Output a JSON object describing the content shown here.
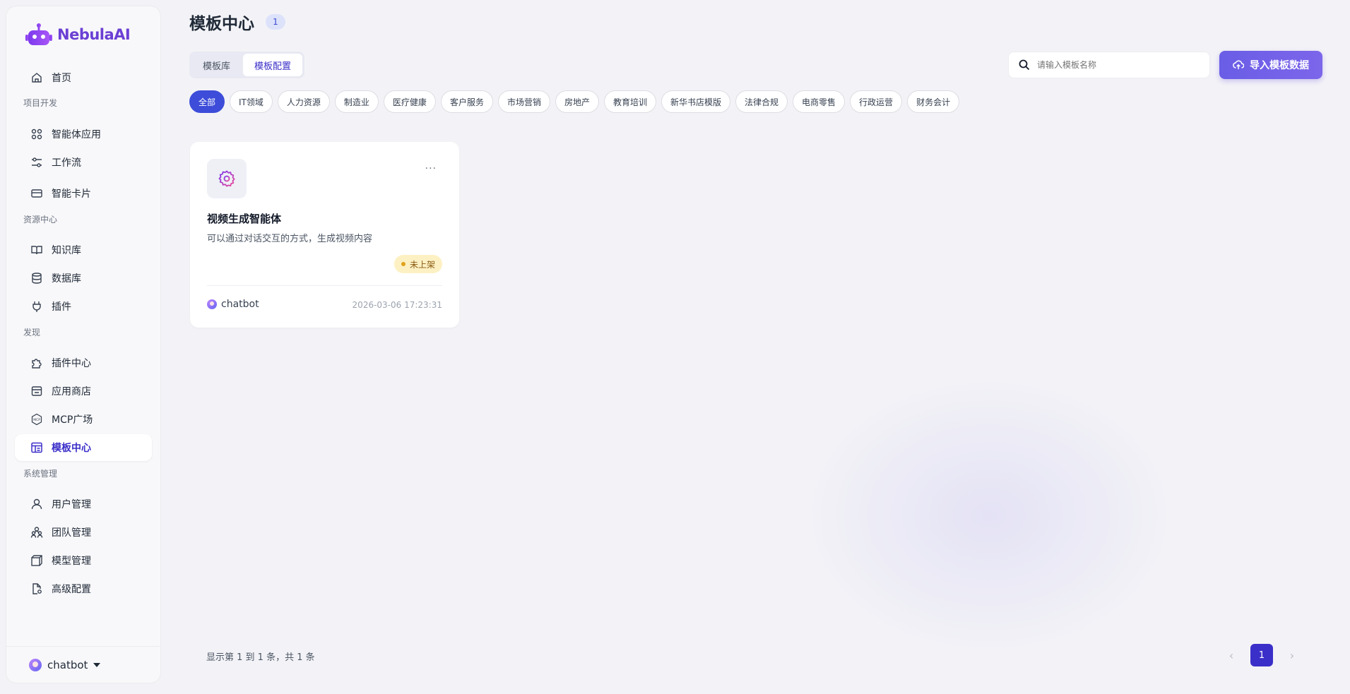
{
  "app": {
    "brand": "NebulaAI",
    "accent": "#3b2fc9"
  },
  "sidebar": {
    "home": "首页",
    "sections": {
      "dev": "项目开发",
      "resources": "资源中心",
      "discover": "发现",
      "system": "系统管理"
    },
    "items": {
      "agent_apps": "智能体应用",
      "workflow": "工作流",
      "smart_cards": "智能卡片",
      "knowledge": "知识库",
      "database": "数据库",
      "plugins": "插件",
      "plugin_center": "插件中心",
      "app_store": "应用商店",
      "mcp_square": "MCP广场",
      "template_center": "模板中心",
      "user_mgmt": "用户管理",
      "team_mgmt": "团队管理",
      "model_mgmt": "模型管理",
      "advanced_config": "高级配置"
    },
    "user": "chatbot"
  },
  "header": {
    "title": "模板中心",
    "count": "1",
    "tabs": [
      "模板库",
      "模板配置"
    ],
    "active_tab": "模板配置",
    "search_placeholder": "请输入模板名称",
    "import_button": "导入模板数据"
  },
  "categories": [
    "全部",
    "IT领域",
    "人力资源",
    "制造业",
    "医疗健康",
    "客户服务",
    "市场营销",
    "房地产",
    "教育培训",
    "新华书店模版",
    "法律合规",
    "电商零售",
    "行政运营",
    "财务会计"
  ],
  "card": {
    "more": "···",
    "title": "视频生成智能体",
    "description": "可以通过对话交互的方式，生成视频内容",
    "status": "未上架",
    "owner": "chatbot",
    "time": "2026-03-06 17:23:31"
  },
  "pagination": {
    "summary": "显示第 1 到 1 条，共 1 条",
    "current": "1",
    "prev": "‹",
    "next": "›"
  }
}
